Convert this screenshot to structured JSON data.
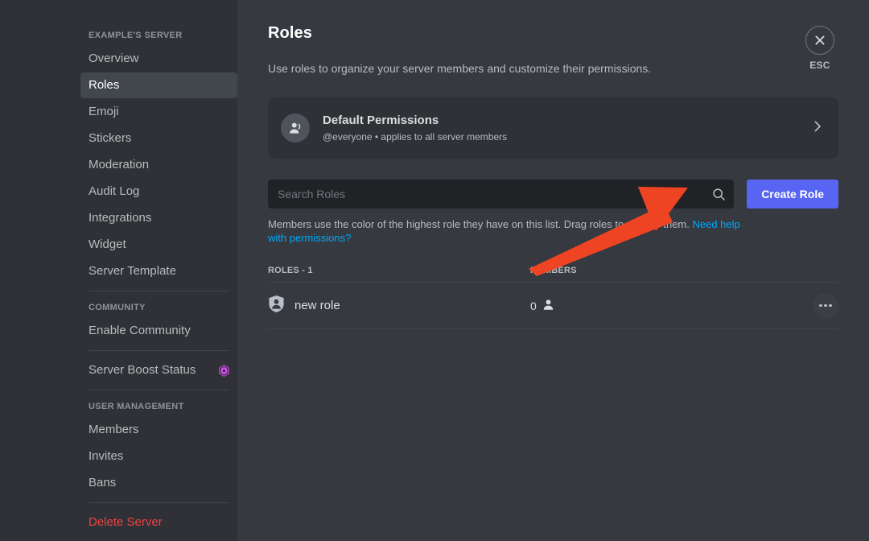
{
  "sidebar": {
    "server_header": "EXAMPLE'S SERVER",
    "items": [
      {
        "label": "Overview",
        "active": false
      },
      {
        "label": "Roles",
        "active": true
      },
      {
        "label": "Emoji",
        "active": false
      },
      {
        "label": "Stickers",
        "active": false
      },
      {
        "label": "Moderation",
        "active": false
      },
      {
        "label": "Audit Log",
        "active": false
      },
      {
        "label": "Integrations",
        "active": false
      },
      {
        "label": "Widget",
        "active": false
      },
      {
        "label": "Server Template",
        "active": false
      }
    ],
    "community_header": "COMMUNITY",
    "community_items": [
      {
        "label": "Enable Community"
      }
    ],
    "boost_item": {
      "label": "Server Boost Status",
      "icon": "boost-gem-icon",
      "icon_color": "#ff73fa"
    },
    "user_management_header": "USER MANAGEMENT",
    "user_management_items": [
      {
        "label": "Members"
      },
      {
        "label": "Invites"
      },
      {
        "label": "Bans"
      }
    ],
    "delete_item": {
      "label": "Delete Server",
      "color": "#ed4245"
    }
  },
  "header": {
    "title": "Roles",
    "subtitle": "Use roles to organize your server members and customize their permissions."
  },
  "default_permissions": {
    "icon": "people-icon",
    "title": "Default Permissions",
    "description": "@everyone • applies to all server members",
    "chevron": "chevron-right-icon"
  },
  "search": {
    "placeholder": "Search Roles",
    "value": "",
    "icon": "search-icon"
  },
  "create_role_button": {
    "label": "Create Role",
    "color": "#5865f2"
  },
  "hint": {
    "text": "Members use the color of the highest role they have on this list. Drag roles to reorder them. ",
    "link_text": "Need help with permissions?",
    "link_color": "#00a8fc"
  },
  "roles_table": {
    "columns": {
      "roles": "ROLES - 1",
      "members": "MEMBERS"
    },
    "rows": [
      {
        "icon": "shield-person-icon",
        "name": "new role",
        "member_count": "0",
        "member_icon": "person-icon",
        "actions_icon": "more-options-icon"
      }
    ]
  },
  "close": {
    "icon": "close-icon",
    "label": "ESC"
  },
  "annotation": {
    "type": "arrow",
    "color": "#ef4423",
    "points_to": "create-role-button"
  }
}
